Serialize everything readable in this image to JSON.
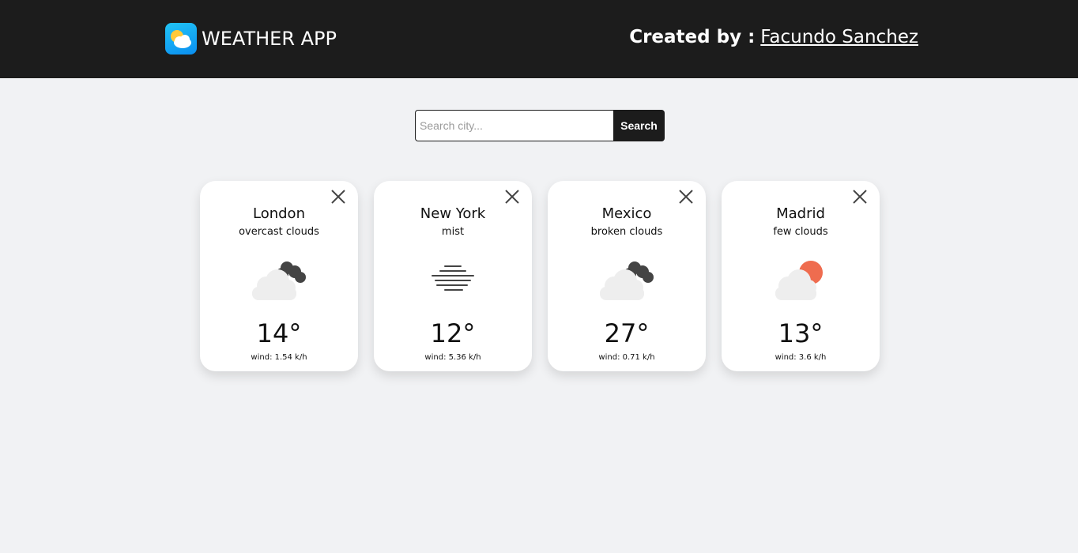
{
  "header": {
    "app_title": "WEATHER APP",
    "credit_prefix": "Created by :",
    "author": "Facundo Sanchez"
  },
  "search": {
    "placeholder": "Search city...",
    "value": "",
    "button_label": "Search"
  },
  "cards": [
    {
      "city": "London",
      "description": "overcast clouds",
      "temperature": "14°",
      "wind": "wind: 1.54 k/h",
      "icon": "overcast-clouds-icon"
    },
    {
      "city": "New York",
      "description": "mist",
      "temperature": "12°",
      "wind": "wind: 5.36 k/h",
      "icon": "mist-icon"
    },
    {
      "city": "Mexico",
      "description": "broken clouds",
      "temperature": "27°",
      "wind": "wind: 0.71 k/h",
      "icon": "broken-clouds-icon"
    },
    {
      "city": "Madrid",
      "description": "few clouds",
      "temperature": "13°",
      "wind": "wind: 3.6 k/h",
      "icon": "few-clouds-icon"
    }
  ],
  "colors": {
    "navbar": "#1c1c1c",
    "background": "#f1f2f4",
    "sun": "#ef6c4f",
    "dark_cloud": "#444444",
    "light_cloud": "#eeeeee"
  }
}
